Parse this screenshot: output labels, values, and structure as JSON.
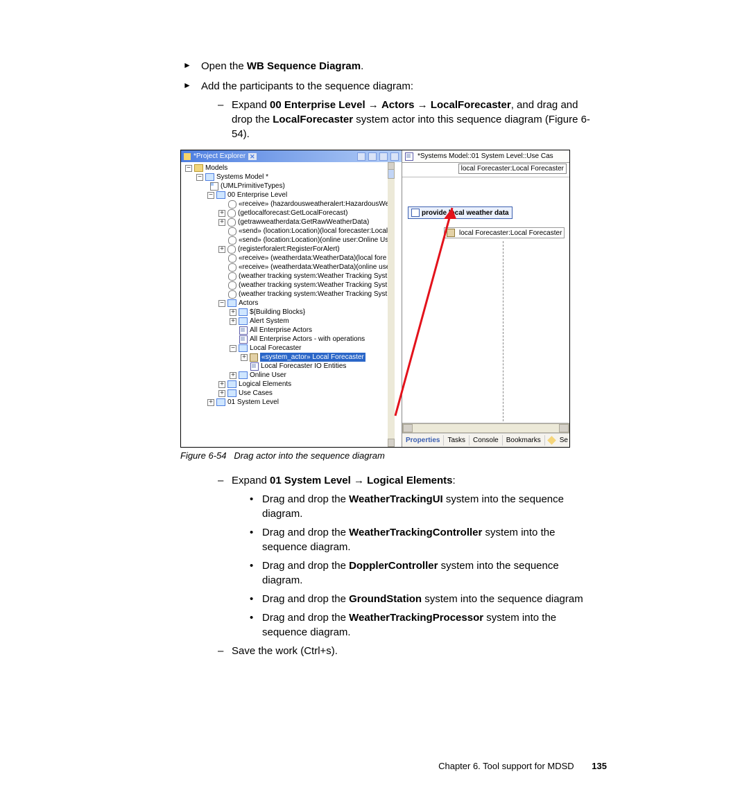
{
  "body": {
    "b1": {
      "pre": "Open the ",
      "bold": "WB Sequence Diagram",
      "post": "."
    },
    "b2": {
      "pre": "Add the participants to the sequence diagram:"
    },
    "d1": {
      "pre": "Expand ",
      "bold1": "00 Enterprise Level",
      "arr1": " → ",
      "bold2": "Actors",
      "arr2": " → ",
      "bold3": "LocalForecaster",
      "post1": ", and drag and drop the ",
      "bold4": "LocalForecaster",
      "post2": " system actor into this sequence diagram (Figure 6-54)."
    },
    "d2": {
      "pre": "Expand ",
      "bold1": "01 System Level",
      "arr1": " → ",
      "bold2": "Logical Elements",
      "post": ":"
    },
    "dot1": {
      "pre": "Drag and drop the ",
      "bold": "WeatherTrackingUI",
      "post": " system into the sequence diagram."
    },
    "dot2": {
      "pre": "Drag and drop the ",
      "bold": "WeatherTrackingController",
      "post": " system into the sequence diagram."
    },
    "dot3": {
      "pre": "Drag and drop the ",
      "bold": "DopplerController",
      "post": " system into the sequence diagram."
    },
    "dot4": {
      "pre": "Drag and drop the ",
      "bold": "GroundStation",
      "post": " system into the sequence diagram"
    },
    "dot5": {
      "pre": "Drag and drop the ",
      "bold": "WeatherTrackingProcessor",
      "post": " system into the sequence diagram."
    },
    "d3": "Save the work (Ctrl+s)."
  },
  "caption": {
    "num": "Figure 6-54",
    "text": "Drag actor into the sequence diagram"
  },
  "footer": {
    "chapter": "Chapter 6. Tool support for MDSD",
    "page": "135"
  },
  "shot": {
    "explorer_title": "*Project Explorer",
    "tree": {
      "models": "Models",
      "systems_model": "Systems Model *",
      "uml_prim": "(UMLPrimitiveTypes)",
      "enterprise": "00 Enterprise Level",
      "ops": [
        "«receive» (hazardousweatheralert:HazardousWe",
        "(getlocalforecast:GetLocalForecast)",
        "(getrawweatherdata:GetRawWeatherData)",
        "«send» (location:Location)(local forecaster:Local",
        "«send» (location:Location)(online user:Online Use",
        "(registerforalert:RegisterForAlert)",
        "«receive» (weatherdata:WeatherData)(local fore",
        "«receive» (weatherdata:WeatherData)(online use",
        "(weather tracking system:Weather Tracking Syst",
        "(weather tracking system:Weather Tracking Syst",
        "(weather tracking system:Weather Tracking Syst"
      ],
      "actors": "Actors",
      "building_blocks": "${Building Blocks}",
      "alert_system": "Alert System",
      "all_ent_actors": "All Enterprise Actors",
      "all_ent_actors_ops": "All Enterprise Actors - with operations",
      "local_forecaster_folder": "Local Forecaster",
      "local_forecaster_sel": "«system_actor» Local Forecaster",
      "local_forecaster_io": "Local Forecaster IO Entities",
      "online_user": "Online User",
      "logical_elements": "Logical Elements",
      "use_cases": "Use Cases",
      "system_level": "01 System Level"
    },
    "diagram_tab": "*Systems Model::01 System Level::Use Cas",
    "lifeline_header": "local Forecaster:Local Forecaster",
    "provide_box": "provide local weather data",
    "drop_label": "local Forecaster:Local Forecaster",
    "tabs_bottom": [
      "Properties",
      "Tasks",
      "Console",
      "Bookmarks"
    ],
    "tabs_bottom_extra": "Se"
  }
}
